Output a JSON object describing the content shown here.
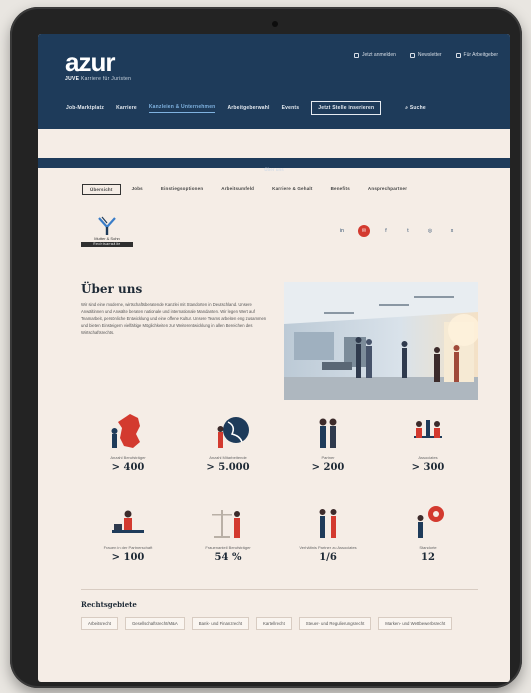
{
  "header": {
    "logo": "azur",
    "logo_sub_brand": "JUVE",
    "logo_sub_text": "Karriere für Juristen",
    "toplinks": [
      "Jetzt anmelden",
      "Newsletter",
      "Für Arbeitgeber"
    ]
  },
  "nav": {
    "items": [
      "Job-Marktplatz",
      "Karriere",
      "Kanzleien & Unternehmen",
      "Arbeitgeberwahl",
      "Events"
    ],
    "active_index": 2,
    "boxed_label": "Jetzt Stelle inserieren",
    "search_label": "Suche"
  },
  "section_bar": {
    "label": "Über uns"
  },
  "tabs": {
    "items": [
      "Übersicht",
      "Jobs",
      "Einstiegsoptionen",
      "Arbeitsumfeld",
      "Karriere & Gehalt",
      "Benefits",
      "Ansprechpartner"
    ],
    "active_index": 0
  },
  "firm": {
    "name": "Mutter & Sohn",
    "tag": "Rechtsanwälte"
  },
  "social": {
    "icons": [
      {
        "name": "linkedin-icon",
        "glyph": "in"
      },
      {
        "name": "mail-icon",
        "glyph": "✉"
      },
      {
        "name": "facebook-icon",
        "glyph": "f"
      },
      {
        "name": "twitter-icon",
        "glyph": "t"
      },
      {
        "name": "instagram-icon",
        "glyph": "◎"
      },
      {
        "name": "xing-icon",
        "glyph": "x"
      }
    ]
  },
  "about": {
    "title": "Über uns",
    "text": "Wir sind eine moderne, wirtschaftsberatende Kanzlei mit Standorten in Deutschland. Unsere Anwältinnen und Anwälte beraten nationale und internationale Mandanten. Wir legen Wert auf Teamarbeit, persönliche Entwicklung und eine offene Kultur. Unsere Teams arbeiten eng zusammen und bieten Einsteigern vielfältige Möglichkeiten zur Weiterentwicklung in allen Bereichen des Wirtschaftsrechts."
  },
  "stats": [
    {
      "label": "Anzahl Berufsträger",
      "value": "> 400",
      "icon": "germany-map-icon"
    },
    {
      "label": "Anzahl Mitarbeitende",
      "value": "> 5.000",
      "icon": "globe-person-icon"
    },
    {
      "label": "Partner",
      "value": "> 200",
      "icon": "partners-icon"
    },
    {
      "label": "Associates",
      "value": "> 300",
      "icon": "meeting-icon"
    },
    {
      "label": "Frauen in der Partnerschaft",
      "value": "> 100",
      "icon": "desk-icon"
    },
    {
      "label": "Frauenanteil Berufsträger",
      "value": "54 %",
      "icon": "scales-icon"
    },
    {
      "label": "Verhältnis Partner zu Associates",
      "value": "1/6",
      "icon": "ratio-icon"
    },
    {
      "label": "Standorte",
      "value": "12",
      "icon": "location-pin-icon"
    }
  ],
  "areas": {
    "title": "Rechtsgebiete",
    "chips": [
      "Arbeitsrecht",
      "Gesellschaftsrecht/M&A",
      "Bank- und Finanzrecht",
      "Kartellrecht",
      "Steuer- und Regulierungsrecht",
      "Marken- und Wettbewerbsrecht"
    ]
  },
  "colors": {
    "header_bg": "#1e3b5a",
    "accent_red": "#d33a2f",
    "page_bg": "#f5ede6"
  }
}
